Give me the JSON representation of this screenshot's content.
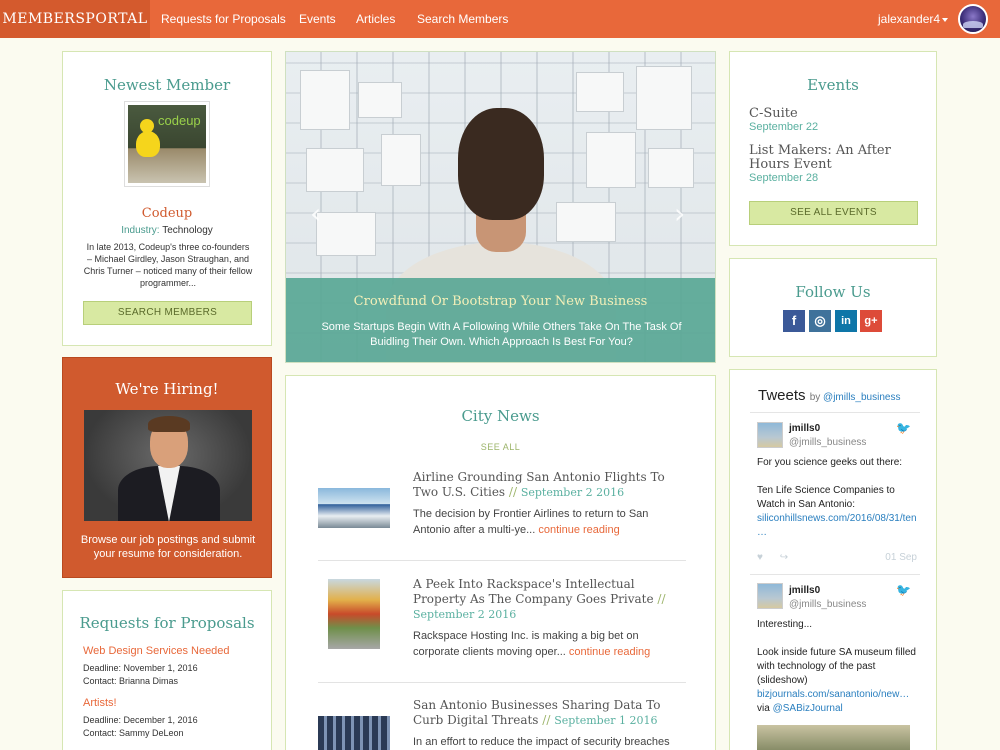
{
  "nav": {
    "brand": "MEMBERSPORTAL",
    "links": [
      "Requests for Proposals",
      "Events",
      "Articles",
      "Search Members"
    ],
    "user": "jalexander4"
  },
  "newest_member": {
    "title": "Newest Member",
    "logo_text": "codeup",
    "name": "Codeup",
    "industry_label": "Industry:",
    "industry": "Technology",
    "description": "In late 2013, Codeup's three co-founders – Michael Girdley, Jason Straughan, and Chris Turner – noticed many of their fellow programmer...",
    "button": "SEARCH MEMBERS"
  },
  "hiring": {
    "title": "We're Hiring!",
    "text": "Browse our job postings and submit your resume for consideration."
  },
  "rfp": {
    "title": "Requests for Proposals",
    "items": [
      {
        "title": "Web Design Services Needed",
        "deadline": "Deadline: November 1, 2016",
        "contact": "Contact: Brianna Dimas"
      },
      {
        "title": "Artists!",
        "deadline": "Deadline: December 1, 2016",
        "contact": "Contact: Sammy DeLeon"
      }
    ]
  },
  "carousel": {
    "title": "Crowdfund Or Bootstrap Your New Business",
    "text": "Some Startups Begin With A Following While Others Take On The Task Of Buidling Their Own. Which Approach Is Best For You?",
    "prev": "‹",
    "next": "›"
  },
  "city_news": {
    "title": "City News",
    "see_all": "SEE ALL",
    "separator": "//",
    "items": [
      {
        "title": "Airline Grounding San Antonio Flights To Two U.S. Cities",
        "date": "September 2 2016",
        "body": "The decision by Frontier Airlines to return to San Antonio after a multi-ye...",
        "more": "continue reading"
      },
      {
        "title": "A Peek Into Rackspace's Intellectual Property As The Company Goes Private",
        "date": "September 2 2016",
        "body": "Rackspace Hosting Inc. is making a big bet on corporate clients moving oper...",
        "more": "continue reading"
      },
      {
        "title": "San Antonio Businesses Sharing Data To Curb Digital Threats",
        "date": "September 1 2016",
        "body": "In an effort to reduce the impact of security breaches",
        "more": ""
      }
    ]
  },
  "events": {
    "title": "Events",
    "items": [
      {
        "name": "C-Suite",
        "date": "September 22"
      },
      {
        "name": "List Makers: An After Hours Event",
        "date": "September 28"
      }
    ],
    "button": "SEE ALL EVENTS"
  },
  "follow": {
    "title": "Follow Us",
    "icons": [
      {
        "name": "facebook-icon",
        "glyph": "f",
        "color": "#3b5998"
      },
      {
        "name": "instagram-icon",
        "glyph": "◎",
        "color": "#3f729b"
      },
      {
        "name": "linkedin-icon",
        "glyph": "in",
        "color": "#0e76a8"
      },
      {
        "name": "googleplus-icon",
        "glyph": "g+",
        "color": "#dd4b39"
      }
    ]
  },
  "tweets": {
    "title": "Tweets",
    "by": "by",
    "handle": "@jmills_business",
    "items": [
      {
        "name": "jmills0",
        "handle": "@jmills_business",
        "line1": "For you science geeks out there:",
        "line2": "Ten Life Science Companies to Watch in San Antonio:",
        "link": "siliconhillsnews.com/2016/08/31/ten …",
        "date": "01 Sep"
      },
      {
        "name": "jmills0",
        "handle": "@jmills_business",
        "line1": "Interesting...",
        "line2": "Look inside future SA museum filled with technology of the past (slideshow)",
        "link": "bizjournals.com/sanantonio/new…",
        "via": "via",
        "via_handle": "@SABizJournal"
      }
    ]
  }
}
